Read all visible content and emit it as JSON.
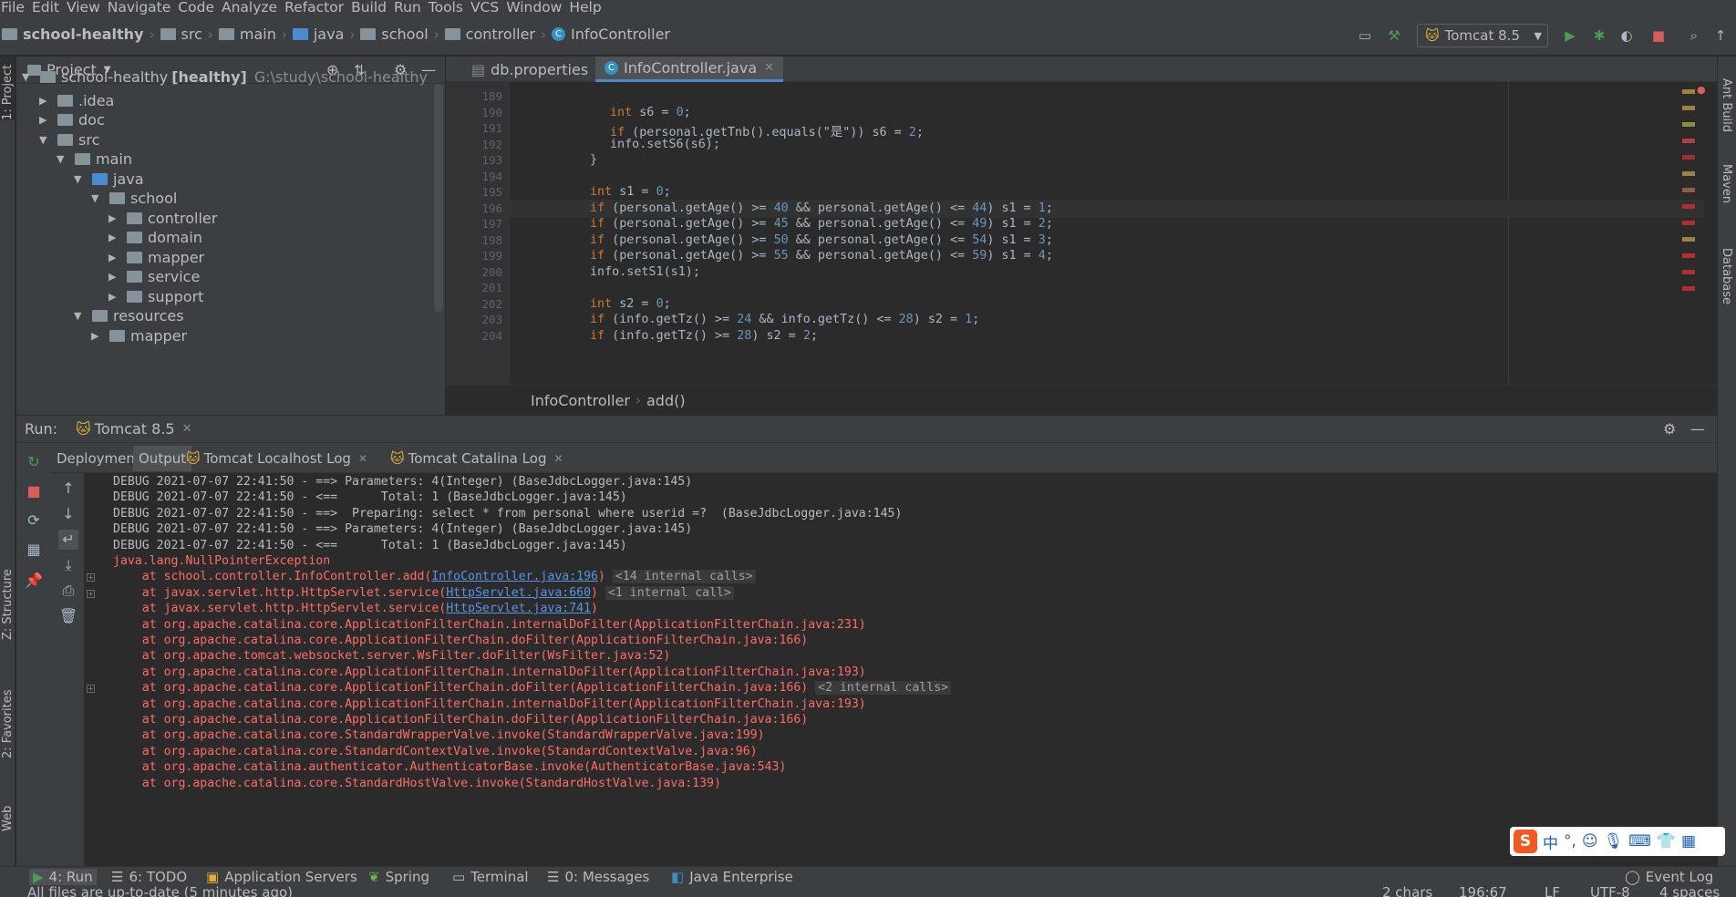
{
  "menu": [
    "File",
    "Edit",
    "View",
    "Navigate",
    "Code",
    "Analyze",
    "Refactor",
    "Build",
    "Run",
    "Tools",
    "VCS",
    "Window",
    "Help"
  ],
  "breadcrumb": [
    "school-healthy",
    "src",
    "main",
    "java",
    "school",
    "controller",
    "InfoController"
  ],
  "run_config": "Tomcat 8.5",
  "project": {
    "header": "Project",
    "root": "school-healthy",
    "root_module": "[healthy]",
    "root_path": "G:\\study\\school-healthy",
    "items": [
      ".idea",
      "doc",
      "src",
      "main",
      "java",
      "school",
      "controller",
      "domain",
      "mapper",
      "service",
      "support",
      "resources",
      "mapper"
    ]
  },
  "left_stripe": {
    "project": "1: Project",
    "structure": "Z: Structure",
    "favorites": "2: Favorites",
    "web": "Web"
  },
  "right_stripe": {
    "ant": "Ant Build",
    "maven": "Maven",
    "database": "Database"
  },
  "editor": {
    "tabs": [
      "db.properties",
      "InfoController.java"
    ],
    "lines": [
      {
        "n": "189",
        "text": ""
      },
      {
        "n": "190",
        "text": "int s6 = 0;"
      },
      {
        "n": "191",
        "text": "if (personal.getTnb().equals(\"是\")) s6 = 2;"
      },
      {
        "n": "192",
        "text": "info.setS6(s6);"
      },
      {
        "n": "193",
        "text": "}"
      },
      {
        "n": "194",
        "text": ""
      },
      {
        "n": "195",
        "text": "int s1 = 0;"
      },
      {
        "n": "196",
        "text": "if (personal.getAge() >= 40 && personal.getAge() <= 44) s1 = 1;"
      },
      {
        "n": "197",
        "text": "if (personal.getAge() >= 45 && personal.getAge() <= 49) s1 = 2;"
      },
      {
        "n": "198",
        "text": "if (personal.getAge() >= 50 && personal.getAge() <= 54) s1 = 3;"
      },
      {
        "n": "199",
        "text": "if (personal.getAge() >= 55 && personal.getAge() <= 59) s1 = 4;"
      },
      {
        "n": "200",
        "text": "info.setS1(s1);"
      },
      {
        "n": "201",
        "text": ""
      },
      {
        "n": "202",
        "text": "int s2 = 0;"
      },
      {
        "n": "203",
        "text": "if (info.getTz() >= 24 && info.getTz() <= 28) s2 = 1;"
      },
      {
        "n": "204",
        "text": "if (info.getTz() >= 28) s2 = 2;"
      }
    ],
    "crumb_class": "InfoController",
    "crumb_method": "add()"
  },
  "run": {
    "label": "Run:",
    "tab": "Tomcat 8.5",
    "subtabs": [
      "Deployment",
      "Output",
      "Tomcat Localhost Log",
      "Tomcat Catalina Log"
    ],
    "console": [
      {
        "t": "DEBUG 2021-07-07 22:41:50 - ==> Parameters: 4(Integer) (BaseJdbcLogger.java:145)",
        "cls": ""
      },
      {
        "t": "DEBUG 2021-07-07 22:41:50 - <==      Total: 1 (BaseJdbcLogger.java:145)",
        "cls": ""
      },
      {
        "t": "DEBUG 2021-07-07 22:41:50 - ==>  Preparing: select * from personal where userid =?  (BaseJdbcLogger.java:145)",
        "cls": ""
      },
      {
        "t": "DEBUG 2021-07-07 22:41:50 - ==> Parameters: 4(Integer) (BaseJdbcLogger.java:145)",
        "cls": ""
      },
      {
        "t": "DEBUG 2021-07-07 22:41:50 - <==      Total: 1 (BaseJdbcLogger.java:145)",
        "cls": ""
      },
      {
        "t": "java.lang.NullPointerException",
        "cls": "err"
      },
      {
        "t": "    at school.controller.InfoController.add(",
        "link": "InfoController.java:196",
        "after": ")",
        "fold": "<14 internal calls>",
        "cls": "err",
        "plus": true
      },
      {
        "t": "    at javax.servlet.http.HttpServlet.service(",
        "link": "HttpServlet.java:660",
        "after": ")",
        "fold": "<1 internal call>",
        "cls": "err",
        "plus": true
      },
      {
        "t": "    at javax.servlet.http.HttpServlet.service(",
        "link": "HttpServlet.java:741",
        "after": ")",
        "cls": "err"
      },
      {
        "t": "    at org.apache.catalina.core.ApplicationFilterChain.internalDoFilter(ApplicationFilterChain.java:231)",
        "cls": "err"
      },
      {
        "t": "    at org.apache.catalina.core.ApplicationFilterChain.doFilter(ApplicationFilterChain.java:166)",
        "cls": "err"
      },
      {
        "t": "    at org.apache.tomcat.websocket.server.WsFilter.doFilter(WsFilter.java:52)",
        "cls": "err"
      },
      {
        "t": "    at org.apache.catalina.core.ApplicationFilterChain.internalDoFilter(ApplicationFilterChain.java:193)",
        "cls": "err"
      },
      {
        "t": "    at org.apache.catalina.core.ApplicationFilterChain.doFilter(ApplicationFilterChain.java:166)",
        "fold": "<2 internal calls>",
        "cls": "err",
        "plus": true
      },
      {
        "t": "    at org.apache.catalina.core.ApplicationFilterChain.internalDoFilter(ApplicationFilterChain.java:193)",
        "cls": "err"
      },
      {
        "t": "    at org.apache.catalina.core.ApplicationFilterChain.doFilter(ApplicationFilterChain.java:166)",
        "cls": "err"
      },
      {
        "t": "    at org.apache.catalina.core.StandardWrapperValve.invoke(StandardWrapperValve.java:199)",
        "cls": "err"
      },
      {
        "t": "    at org.apache.catalina.core.StandardContextValve.invoke(StandardContextValve.java:96)",
        "cls": "err"
      },
      {
        "t": "    at org.apache.catalina.authenticator.AuthenticatorBase.invoke(AuthenticatorBase.java:543)",
        "cls": "err"
      },
      {
        "t": "    at org.apache.catalina.core.StandardHostValve.invoke(StandardHostValve.java:139)",
        "cls": "err"
      }
    ]
  },
  "bottom_tools": [
    "4: Run",
    "6: TODO",
    "Application Servers",
    "Spring",
    "Terminal",
    "0: Messages",
    "Java Enterprise",
    "Event Log"
  ],
  "status": {
    "message": "All files are up-to-date (5 minutes ago)",
    "chars": "2 chars",
    "pos": "196:67",
    "lf": "LF",
    "enc": "UTF-8",
    "indent": "4 spaces"
  },
  "ime": {
    "label": "中"
  },
  "colors": {
    "bg": "#2b2b2b",
    "panel": "#3c3f41",
    "keyword": "#cc7832",
    "number": "#6897bb",
    "error": "#ff6b68",
    "link": "#5894e2",
    "run_green": "#499c54"
  }
}
